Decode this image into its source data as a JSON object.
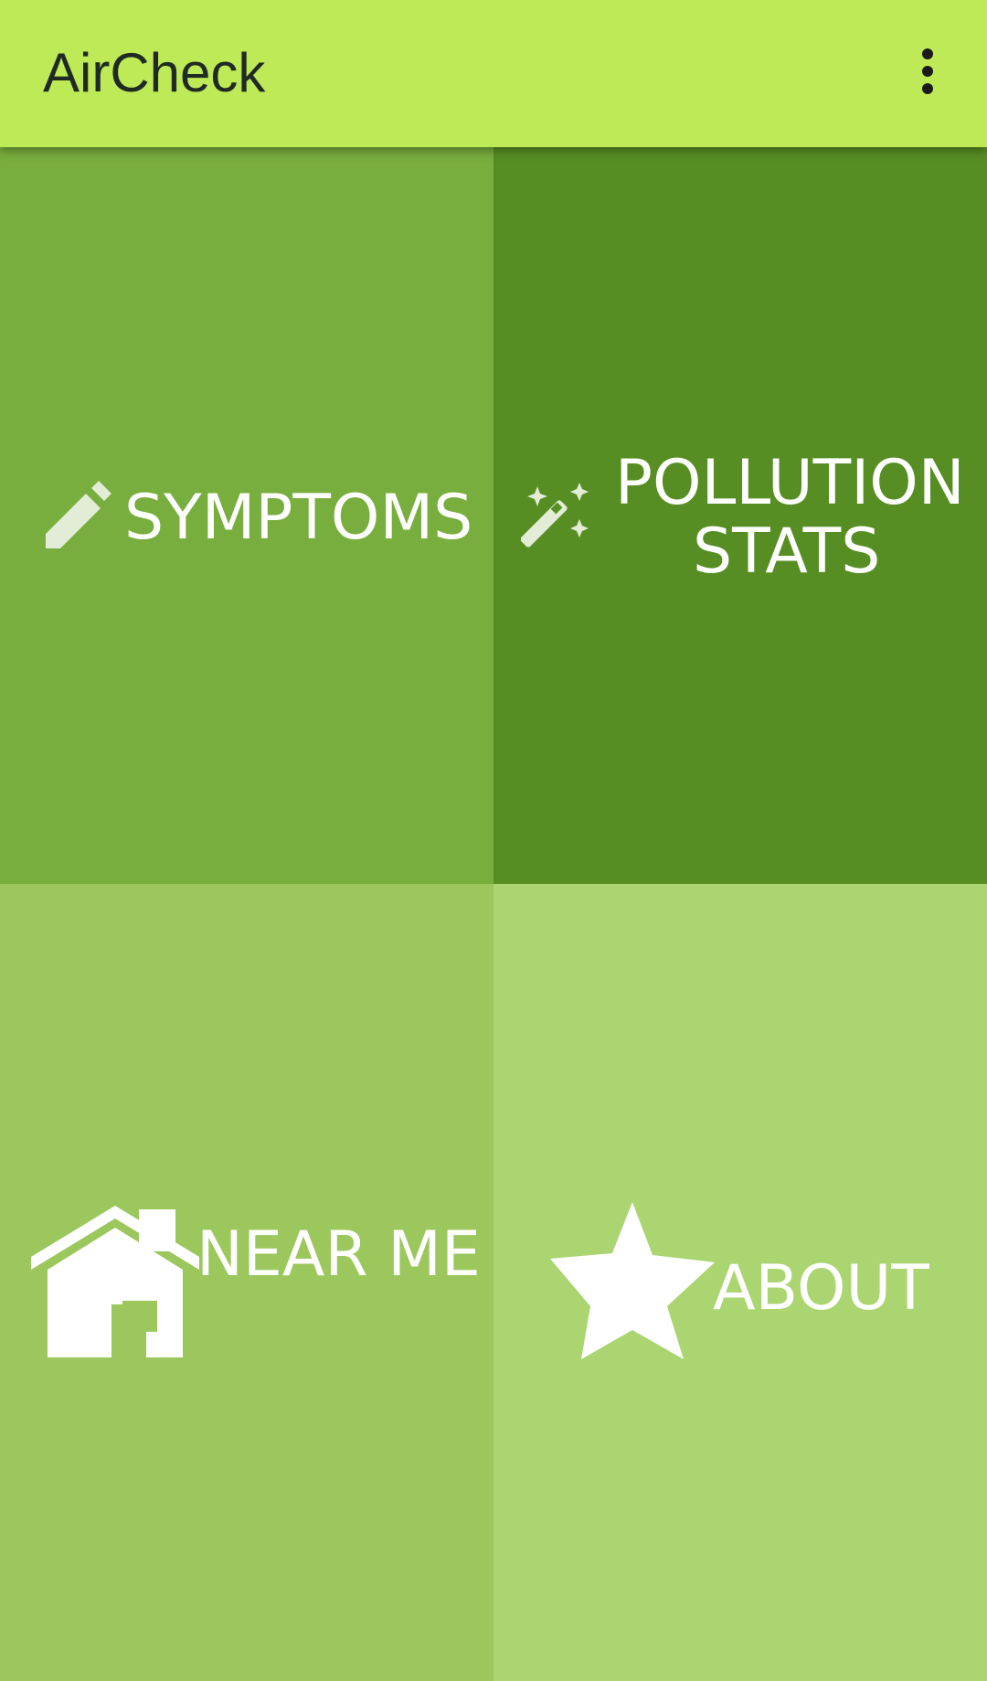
{
  "app_bar": {
    "title": "AirCheck",
    "menu_icon": "more-vert-icon",
    "background": "#bfea57"
  },
  "tiles": [
    {
      "label": "SYMPTOMS",
      "icon": "pencil-icon",
      "background": "#78ae3d"
    },
    {
      "label_line1": "POLLUTION",
      "label_line2": "STATS",
      "icon": "magic-wand-icon",
      "background": "#578e23"
    },
    {
      "label": "NEAR ME",
      "icon": "home-icon",
      "background": "#9bc75c"
    },
    {
      "label": "ABOUT",
      "icon": "star-icon",
      "background": "#aad571"
    }
  ]
}
